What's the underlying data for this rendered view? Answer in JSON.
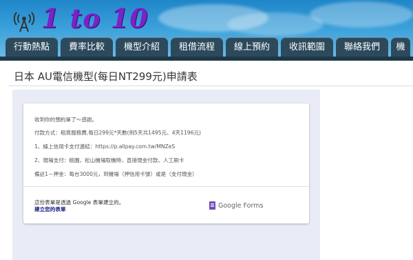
{
  "logo": {
    "text": "1 to 10",
    "icon": "antenna-signal-icon"
  },
  "nav": {
    "tabs": [
      "行動熱點",
      "費率比較",
      "機型介紹",
      "租借流程",
      "線上預約",
      "收訊範圍",
      "聯絡我們",
      "機"
    ]
  },
  "page": {
    "title": "日本 AU電信機型(每日NT299元)申請表"
  },
  "form_response": {
    "messages": [
      "收到你的預約單了～感謝。",
      "付款方式：租賃服務費,每日299元*天數(例5天共1495元、4天1196元)",
      "1、線上信用卡支付連結：https://p.allpay.com.tw/MNZeS",
      "2、現場支付：桃園、松山機場取機時，直接現金付款、人工刷卡",
      "備註1－押金：每台3000元，到機場（押信用卡號）或是（支付現金）"
    ],
    "footer_note": "這份表單是透過 Google 表單建立的。",
    "footer_link": "建立您的表單",
    "brand": "Google Forms"
  }
}
